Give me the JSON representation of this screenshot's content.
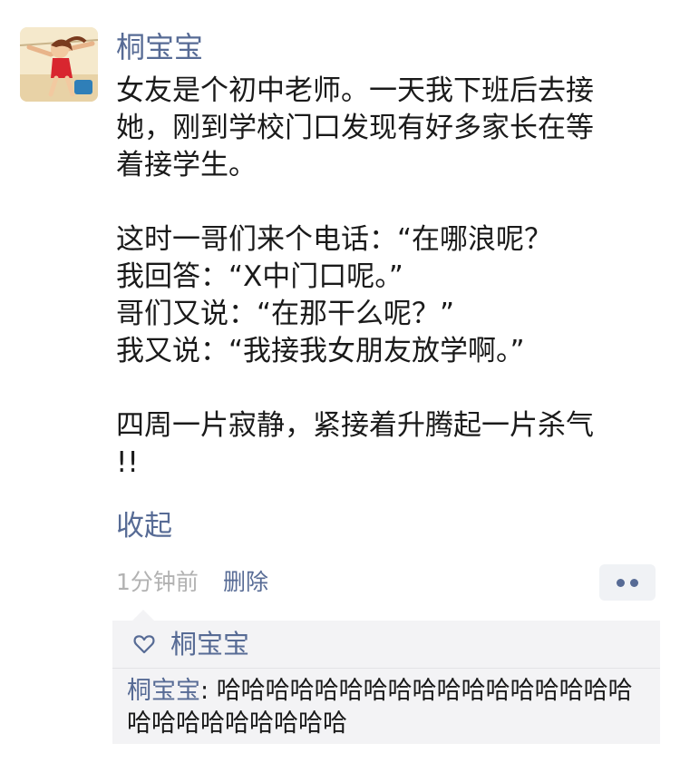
{
  "post": {
    "author": "桐宝宝",
    "avatar_icon": "cartoon-girl-avatar-icon",
    "lines": [
      "女友是个初中老师。一天我下班后去接",
      "她，刚到学校门口发现有好多家长在等",
      "着接学生。",
      "",
      "这时一哥们来个电话：“在哪浪呢？",
      "我回答：“X中门口呢。”",
      "哥们又说：“在那干么呢？”",
      "我又说：“我接我女朋友放学啊。”",
      "",
      "四周一片寂静，紧接着升腾起一片杀气",
      "!!"
    ],
    "collapse_label": "收起",
    "time": "1分钟前",
    "delete_label": "删除",
    "more_icon": "more-dots-icon"
  },
  "likes": {
    "icon": "heart-icon",
    "names": "桐宝宝"
  },
  "comments": [
    {
      "author": "桐宝宝",
      "separator": ": ",
      "text": "哈哈哈哈哈哈哈哈哈哈哈哈哈哈哈哈哈哈哈哈哈哈哈哈哈哈"
    }
  ],
  "colors": {
    "link": "#576b95",
    "meta": "#b2b2b2",
    "text": "#1a1a1a",
    "comment_bg": "#f3f3f5"
  }
}
